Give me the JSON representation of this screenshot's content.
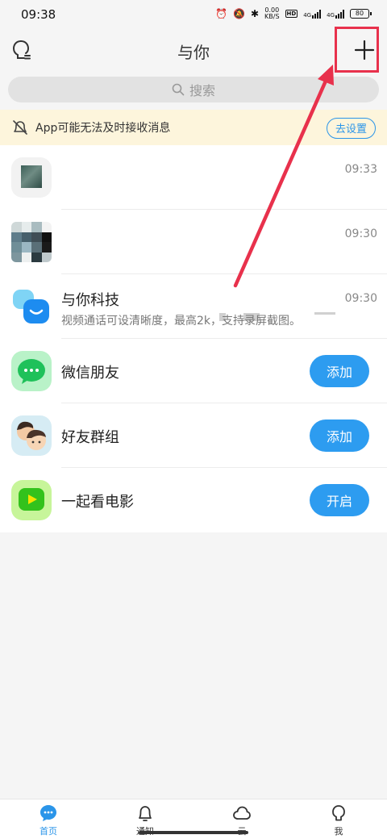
{
  "status_bar": {
    "time": "09:38",
    "net_speed_value": "0.00",
    "net_speed_unit": "KB/S",
    "hd_label": "HD",
    "signal_1_label": "4G",
    "signal_2_label": "4G",
    "battery": "80"
  },
  "header": {
    "title": "与你",
    "left_icon": "profile-icon",
    "right_icon": "plus-icon"
  },
  "search": {
    "placeholder": "搜索",
    "icon": "search-icon"
  },
  "notice": {
    "text": "App可能无法及时接收消息",
    "button": "去设置",
    "icon": "notification-off-icon"
  },
  "list": [
    {
      "name": "",
      "time": "09:33"
    },
    {
      "name": "",
      "time": "09:30"
    },
    {
      "name": "与你科技",
      "subtitle": "视频通话可设清晰度，最高2k，支持录屏截图。",
      "time": "09:30"
    },
    {
      "name": "微信朋友",
      "action": "添加"
    },
    {
      "name": "好友群组",
      "action": "添加"
    },
    {
      "name": "一起看电影",
      "action": "开启"
    }
  ],
  "tabbar": [
    {
      "label": "首页",
      "icon": "chat-bubble-icon",
      "active": true
    },
    {
      "label": "通知",
      "icon": "bell-icon",
      "active": false
    },
    {
      "label": "云",
      "icon": "cloud-icon",
      "active": false
    },
    {
      "label": "我",
      "icon": "profile-icon",
      "active": false
    }
  ],
  "colors": {
    "accent": "#2b95e9",
    "annotation": "#e8314c",
    "notice_bg": "#fdf5dc",
    "action_button": "#2d9cf0"
  }
}
